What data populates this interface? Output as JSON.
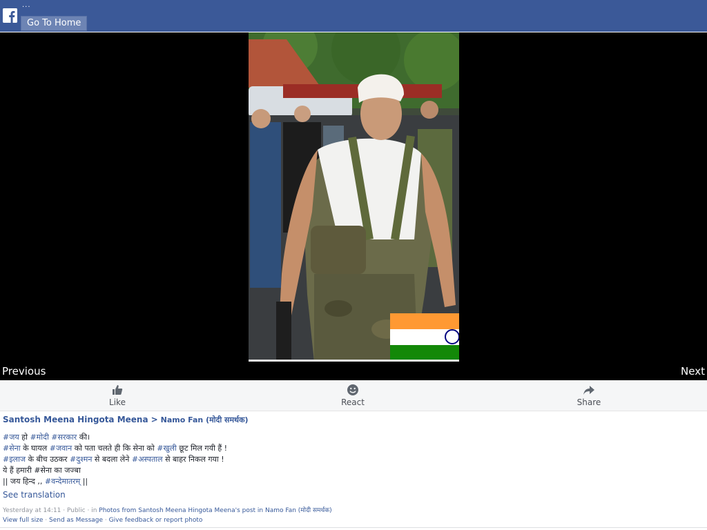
{
  "header": {
    "dots": "...",
    "home_button": "Go To Home"
  },
  "photo": {
    "flag_colors": {
      "saffron": "#ff9933",
      "white": "#ffffff",
      "green": "#138808",
      "chakra": "#000080"
    }
  },
  "navigation": {
    "previous": "Previous",
    "next": "Next"
  },
  "actions": {
    "like": "Like",
    "react": "React",
    "share": "Share"
  },
  "post": {
    "author": "Santosh Meena Hingota Meena",
    "separator": ">",
    "group": "Namo Fan (मोदी समर्थक)",
    "lines": [
      [
        {
          "t": "#जय",
          "tag": true
        },
        {
          "t": " हो ",
          "tag": false
        },
        {
          "t": "#मोदी",
          "tag": true
        },
        {
          "t": " ",
          "tag": false
        },
        {
          "t": "#सरकार",
          "tag": true
        },
        {
          "t": " की।",
          "tag": false
        }
      ],
      [
        {
          "t": "#सेना",
          "tag": true
        },
        {
          "t": " के घायल ",
          "tag": false
        },
        {
          "t": "#जवान",
          "tag": true
        },
        {
          "t": " को पता चलते ही कि सेना को ",
          "tag": false
        },
        {
          "t": "#खुली",
          "tag": true
        },
        {
          "t": " छूट मिल गयी हैं !",
          "tag": false
        }
      ],
      [
        {
          "t": "#इलाज",
          "tag": true
        },
        {
          "t": " के बीच उठकर ",
          "tag": false
        },
        {
          "t": "#दुश्मन",
          "tag": true
        },
        {
          "t": " से बदला लेने ",
          "tag": false
        },
        {
          "t": "#अस्पताल",
          "tag": true
        },
        {
          "t": " से बाहर निकल गया !",
          "tag": false
        }
      ],
      [
        {
          "t": "ये हैं हमारी #सेना का जज्बा",
          "tag": false
        }
      ],
      [
        {
          "t": "|| जय हिन्द ,, ",
          "tag": false
        },
        {
          "t": "#वन्देमातरम्",
          "tag": true
        },
        {
          "t": " ||",
          "tag": false
        }
      ]
    ],
    "see_translation": "See translation",
    "meta_prefix": "Yesterday at 14:11 · Public · in ",
    "meta_link": "Photos from Santosh Meena Hingota Meena's post in Namo Fan (मोदी समर्थक)",
    "footer_links": [
      "View full size",
      "Send as Message",
      "Give feedback or report photo"
    ],
    "footer_separator": " · "
  },
  "colors": {
    "brand": "#3b5998",
    "link": "#365899",
    "button": "#6d84b4"
  }
}
